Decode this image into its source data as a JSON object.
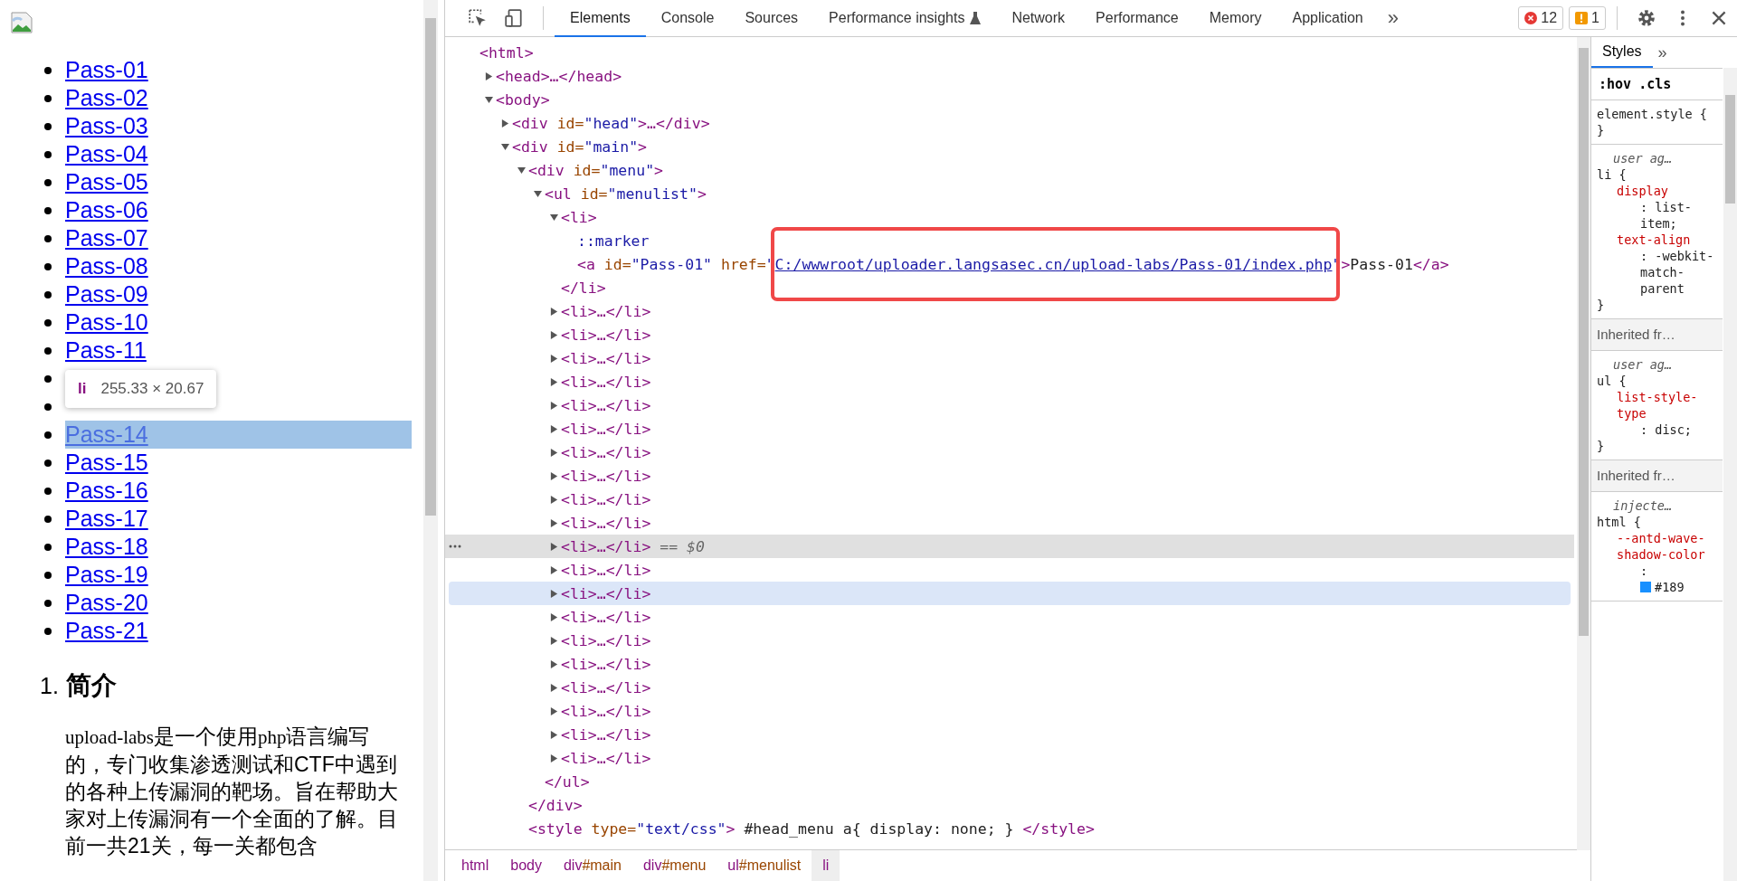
{
  "page": {
    "links": [
      {
        "label": "Pass-01",
        "hovered": false
      },
      {
        "label": "Pass-02",
        "hovered": false
      },
      {
        "label": "Pass-03",
        "hovered": false
      },
      {
        "label": "Pass-04",
        "hovered": false
      },
      {
        "label": "Pass-05",
        "hovered": false
      },
      {
        "label": "Pass-06",
        "hovered": false
      },
      {
        "label": "Pass-07",
        "hovered": false
      },
      {
        "label": "Pass-08",
        "hovered": false
      },
      {
        "label": "Pass-09",
        "hovered": false
      },
      {
        "label": "Pass-10",
        "hovered": false
      },
      {
        "label": "Pass-11",
        "hovered": false
      },
      {
        "hovered": false
      },
      {
        "hovered": false
      },
      {
        "label": "Pass-14",
        "hovered": true
      },
      {
        "label": "Pass-15",
        "hovered": false
      },
      {
        "label": "Pass-16",
        "hovered": false
      },
      {
        "label": "Pass-17",
        "hovered": false
      },
      {
        "label": "Pass-18",
        "hovered": false
      },
      {
        "label": "Pass-19",
        "hovered": false
      },
      {
        "label": "Pass-20",
        "hovered": false
      },
      {
        "label": "Pass-21",
        "hovered": false
      }
    ],
    "tooltip": {
      "tag": "li",
      "size": "255.33 × 20.67"
    },
    "section": {
      "number": "1.",
      "title": "简介"
    },
    "intro": [
      {
        "kind": "code",
        "text": "upload-labs"
      },
      {
        "kind": "plain",
        "text": "是一个使用"
      },
      {
        "kind": "code",
        "text": "php"
      },
      {
        "kind": "plain",
        "text": "语言编写的，专门收集渗透测试和CTF中遇到的各种上传漏洞的靶场。旨在帮助大家对上传漏洞有一个全面的了解。目前一共21关，每一关都包含"
      }
    ]
  },
  "devtools": {
    "tabs": [
      {
        "label": "Elements",
        "selected": true,
        "experimental": false
      },
      {
        "label": "Console",
        "selected": false,
        "experimental": false
      },
      {
        "label": "Sources",
        "selected": false,
        "experimental": false
      },
      {
        "label": "Performance insights",
        "selected": false,
        "experimental": true
      },
      {
        "label": "Network",
        "selected": false,
        "experimental": false
      },
      {
        "label": "Performance",
        "selected": false,
        "experimental": false
      },
      {
        "label": "Memory",
        "selected": false,
        "experimental": false
      },
      {
        "label": "Application",
        "selected": false,
        "experimental": false
      }
    ],
    "more_tabs": "»",
    "errors": "12",
    "warnings": "1",
    "tree": [
      {
        "segments": [
          {
            "kind": "tag",
            "text": "<html>"
          }
        ],
        "children": [
          {
            "expanded": false,
            "segments": [
              {
                "kind": "tag",
                "text": "<head>…</head>"
              }
            ]
          },
          {
            "expanded": true,
            "segments": [
              {
                "kind": "tag",
                "text": "<body>"
              }
            ],
            "children": [
              {
                "expanded": false,
                "segments": [
                  {
                    "kind": "tag",
                    "text": "<div "
                  },
                  {
                    "kind": "attr",
                    "text": "id="
                  },
                  {
                    "kind": "value",
                    "text": "\"head\""
                  },
                  {
                    "kind": "tag",
                    "text": ">…</div>"
                  }
                ]
              },
              {
                "expanded": true,
                "segments": [
                  {
                    "kind": "tag",
                    "text": "<div "
                  },
                  {
                    "kind": "attr",
                    "text": "id="
                  },
                  {
                    "kind": "value",
                    "text": "\"main\""
                  },
                  {
                    "kind": "tag",
                    "text": ">"
                  }
                ],
                "children": [
                  {
                    "expanded": true,
                    "segments": [
                      {
                        "kind": "tag",
                        "text": "<div "
                      },
                      {
                        "kind": "attr",
                        "text": "id="
                      },
                      {
                        "kind": "value",
                        "text": "\"menu\""
                      },
                      {
                        "kind": "tag",
                        "text": ">"
                      }
                    ],
                    "closing": [
                      {
                        "kind": "tag",
                        "text": "</div>"
                      }
                    ],
                    "children": [
                      {
                        "expanded": true,
                        "segments": [
                          {
                            "kind": "tag",
                            "text": "<ul "
                          },
                          {
                            "kind": "attr",
                            "text": "id="
                          },
                          {
                            "kind": "value",
                            "text": "\"menulist\""
                          },
                          {
                            "kind": "tag",
                            "text": ">"
                          }
                        ],
                        "closing": [
                          {
                            "kind": "tag",
                            "text": "</ul>"
                          }
                        ],
                        "children": [
                          {
                            "expanded": true,
                            "selected": false,
                            "hovered": false,
                            "segments": [
                              {
                                "kind": "tag",
                                "text": "<li>"
                              }
                            ],
                            "closing": [
                              {
                                "kind": "tag",
                                "text": "</li>"
                              }
                            ],
                            "children": [
                              {
                                "segments": [
                                  {
                                    "kind": "pseudo",
                                    "text": "::marker"
                                  }
                                ]
                              },
                              {
                                "segments": [
                                  {
                                    "kind": "tag",
                                    "text": "<a "
                                  },
                                  {
                                    "kind": "attr",
                                    "text": "id="
                                  },
                                  {
                                    "kind": "value",
                                    "text": "\"Pass-01\" "
                                  },
                                  {
                                    "kind": "attr",
                                    "text": "href="
                                  },
                                  {
                                    "kind": "value",
                                    "text": "\""
                                  },
                                  {
                                    "kind": "link",
                                    "text": "C:/wwwroot/uploader.langsasec.cn/upload-labs/Pass-01/index.php",
                                    "highlighted": true
                                  },
                                  {
                                    "kind": "value",
                                    "text": "\""
                                  },
                                  {
                                    "kind": "tag",
                                    "text": ">"
                                  },
                                  {
                                    "kind": "text",
                                    "text": "Pass-01"
                                  },
                                  {
                                    "kind": "tag",
                                    "text": "</a>"
                                  }
                                ]
                              }
                            ]
                          },
                          {
                            "expanded": false,
                            "selected": false,
                            "hovered": false,
                            "segments": [
                              {
                                "kind": "tag",
                                "text": "<li>…</li>"
                              }
                            ]
                          },
                          {
                            "expanded": false,
                            "selected": false,
                            "hovered": false,
                            "segments": [
                              {
                                "kind": "tag",
                                "text": "<li>…</li>"
                              }
                            ]
                          },
                          {
                            "expanded": false,
                            "selected": false,
                            "hovered": false,
                            "segments": [
                              {
                                "kind": "tag",
                                "text": "<li>…</li>"
                              }
                            ]
                          },
                          {
                            "expanded": false,
                            "selected": false,
                            "hovered": false,
                            "segments": [
                              {
                                "kind": "tag",
                                "text": "<li>…</li>"
                              }
                            ]
                          },
                          {
                            "expanded": false,
                            "selected": false,
                            "hovered": false,
                            "segments": [
                              {
                                "kind": "tag",
                                "text": "<li>…</li>"
                              }
                            ]
                          },
                          {
                            "expanded": false,
                            "selected": false,
                            "hovered": false,
                            "segments": [
                              {
                                "kind": "tag",
                                "text": "<li>…</li>"
                              }
                            ]
                          },
                          {
                            "expanded": false,
                            "selected": false,
                            "hovered": false,
                            "segments": [
                              {
                                "kind": "tag",
                                "text": "<li>…</li>"
                              }
                            ]
                          },
                          {
                            "expanded": false,
                            "selected": false,
                            "hovered": false,
                            "segments": [
                              {
                                "kind": "tag",
                                "text": "<li>…</li>"
                              }
                            ]
                          },
                          {
                            "expanded": false,
                            "selected": false,
                            "hovered": false,
                            "segments": [
                              {
                                "kind": "tag",
                                "text": "<li>…</li>"
                              }
                            ]
                          },
                          {
                            "expanded": false,
                            "selected": false,
                            "hovered": false,
                            "segments": [
                              {
                                "kind": "tag",
                                "text": "<li>…</li>"
                              }
                            ]
                          },
                          {
                            "expanded": false,
                            "selected": true,
                            "hovered": false,
                            "segments": [
                              {
                                "kind": "tag",
                                "text": "<li>…</li>"
                              },
                              {
                                "kind": "note",
                                "text": " == $0"
                              }
                            ]
                          },
                          {
                            "expanded": false,
                            "selected": false,
                            "hovered": false,
                            "segments": [
                              {
                                "kind": "tag",
                                "text": "<li>…</li>"
                              }
                            ]
                          },
                          {
                            "expanded": false,
                            "selected": false,
                            "hovered": true,
                            "segments": [
                              {
                                "kind": "tag",
                                "text": "<li>…</li>"
                              }
                            ]
                          },
                          {
                            "expanded": false,
                            "selected": false,
                            "hovered": false,
                            "segments": [
                              {
                                "kind": "tag",
                                "text": "<li>…</li>"
                              }
                            ]
                          },
                          {
                            "expanded": false,
                            "selected": false,
                            "hovered": false,
                            "segments": [
                              {
                                "kind": "tag",
                                "text": "<li>…</li>"
                              }
                            ]
                          },
                          {
                            "expanded": false,
                            "selected": false,
                            "hovered": false,
                            "segments": [
                              {
                                "kind": "tag",
                                "text": "<li>…</li>"
                              }
                            ]
                          },
                          {
                            "expanded": false,
                            "selected": false,
                            "hovered": false,
                            "segments": [
                              {
                                "kind": "tag",
                                "text": "<li>…</li>"
                              }
                            ]
                          },
                          {
                            "expanded": false,
                            "selected": false,
                            "hovered": false,
                            "segments": [
                              {
                                "kind": "tag",
                                "text": "<li>…</li>"
                              }
                            ]
                          },
                          {
                            "expanded": false,
                            "selected": false,
                            "hovered": false,
                            "segments": [
                              {
                                "kind": "tag",
                                "text": "<li>…</li>"
                              }
                            ]
                          },
                          {
                            "expanded": false,
                            "selected": false,
                            "hovered": false,
                            "segments": [
                              {
                                "kind": "tag",
                                "text": "<li>…</li>"
                              }
                            ]
                          }
                        ]
                      }
                    ]
                  },
                  {
                    "segments": [
                      {
                        "kind": "tag",
                        "text": "<style "
                      },
                      {
                        "kind": "attr",
                        "text": "type="
                      },
                      {
                        "kind": "value",
                        "text": "\"text/css\""
                      },
                      {
                        "kind": "tag",
                        "text": ">"
                      },
                      {
                        "kind": "text",
                        "text": " #head_menu a{ display: none; } "
                      },
                      {
                        "kind": "tag",
                        "text": "</style>"
                      }
                    ]
                  }
                ]
              }
            ]
          }
        ]
      }
    ],
    "breadcrumbs": [
      {
        "tag": "html",
        "selected": false
      },
      {
        "tag": "body",
        "selected": false
      },
      {
        "tag": "div",
        "id": "#main",
        "selected": false
      },
      {
        "tag": "div",
        "id": "#menu",
        "selected": false
      },
      {
        "tag": "ul",
        "id": "#menulist",
        "selected": false
      },
      {
        "tag": "li",
        "selected": true
      }
    ],
    "styles": {
      "tabs": [
        {
          "label": "Styles",
          "selected": true
        }
      ],
      "more": "»",
      "filters": [
        ":hov",
        ".cls"
      ],
      "sections": [
        {
          "kind": "rule",
          "selector": "element.style {",
          "close": "}"
        },
        {
          "kind": "rule",
          "source": "user ag…",
          "selector": "li {",
          "close": "}",
          "props": [
            {
              "name": "display",
              "value": ": list-item;"
            },
            {
              "name": "text-align",
              "value": ": -webkit-match-parent"
            }
          ]
        },
        {
          "kind": "inherited",
          "label": "Inherited fr…"
        },
        {
          "kind": "rule",
          "source": "user ag…",
          "selector": "ul {",
          "close": "}",
          "props": [
            {
              "name": "list-style-type",
              "value": ": disc;"
            }
          ]
        },
        {
          "kind": "inherited",
          "label": "Inherited fr…"
        },
        {
          "kind": "rule",
          "source": "injecte…",
          "selector": "html {",
          "props": [
            {
              "name": "--antd-wave-shadow-color",
              "value": ":",
              "color": "#1890ff",
              "color_value": "#189"
            }
          ]
        }
      ]
    }
  }
}
